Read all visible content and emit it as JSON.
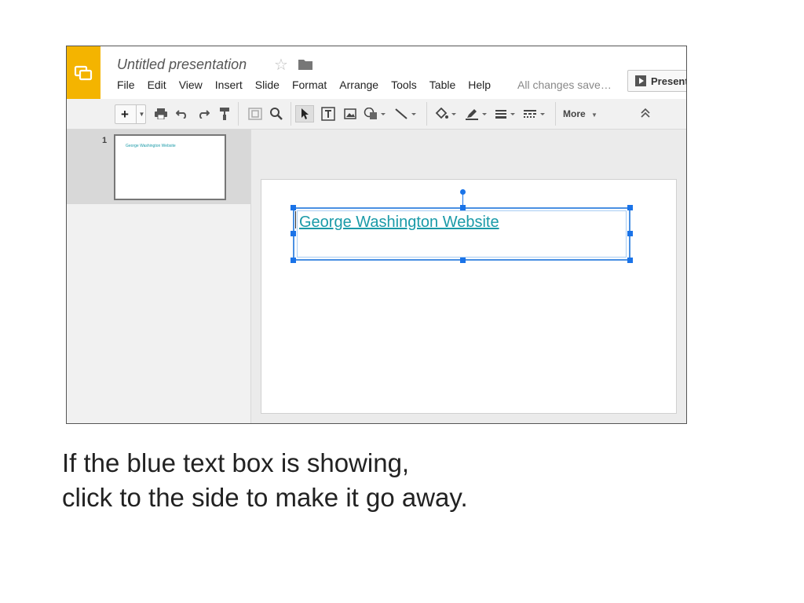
{
  "header": {
    "doc_title": "Untitled presentation",
    "menu": [
      "File",
      "Edit",
      "View",
      "Insert",
      "Slide",
      "Format",
      "Arrange",
      "Tools",
      "Table",
      "Help"
    ],
    "save_status": "All changes save…",
    "present_label": "Present"
  },
  "toolbar": {
    "new_slide_label": "+",
    "more_label": "More"
  },
  "filmstrip": {
    "slides": [
      {
        "number": "1",
        "thumb_text": "George Washington Website"
      }
    ]
  },
  "slide": {
    "link_text": "George Washington Website",
    "link_color": "#1a9aa8",
    "selection_color": "#1a73e8"
  },
  "caption": {
    "line1": "If the blue text box is showing,",
    "line2": "click to the side to make it go away."
  },
  "colors": {
    "brand": "#f4b400"
  }
}
